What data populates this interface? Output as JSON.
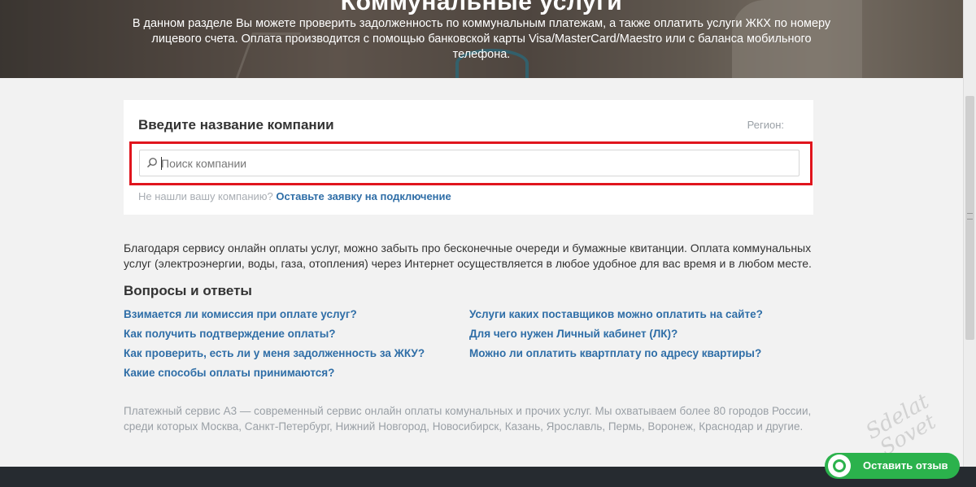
{
  "hero": {
    "heading": "Коммунальные услуги",
    "intro": "В данном разделе Вы можете проверить задолженность по коммунальным платежам, а также оплатить услуги ЖКХ по номеру лицевого счета. Оплата производится с помощью банковской карты Visa/MasterCard/Maestro или с баланса мобильного телефона."
  },
  "search_card": {
    "title": "Введите название компании",
    "region_label": "Регион:",
    "search_placeholder": "Поиск компании",
    "hint_text": "Не нашли вашу компанию?",
    "hint_link": "Оставьте заявку на подключение"
  },
  "description": "Благодаря сервису онлайн оплаты услуг, можно забыть про бесконечные очереди и бумажные квитанции. Оплата коммунальных услуг (электроэнергии, воды, газа, отопления) через Интернет осуществляется в любое удобное для вас время и в любом месте.",
  "faq": {
    "title": "Вопросы и ответы",
    "left": [
      "Взимается ли комиссия при оплате услуг?",
      "Как получить подтверждение оплаты?",
      "Как проверить, есть ли у меня задолженность за ЖКУ?",
      "Какие способы оплаты принимаются?"
    ],
    "right": [
      "Услуги каких поставщиков можно оплатить на сайте?",
      "Для чего нужен Личный кабинет (ЛК)?",
      "Можно ли оплатить квартплату по адресу квартиры?"
    ]
  },
  "footer_note": "Платежный сервис А3 — современный сервис онлайн оплаты комунальных и прочих услуг. Мы охватываем более 80 городов России, среди которых Москва, Санкт-Петербург, Нижний Новгород, Новосибирск, Казань, Ярославль, Пермь, Воронеж, Краснодар и другие.",
  "feedback_button": "Оставить отзыв",
  "watermark": {
    "line1": "Sdelat",
    "line2": "Sovet"
  },
  "colors": {
    "link": "#2f6ea7",
    "highlight_border": "#e0151d",
    "feedback_green": "#2bb24c",
    "bottom_bar": "#262b30"
  },
  "icons": {
    "search": "search-icon",
    "feedback": "chat-bubble-icon"
  }
}
